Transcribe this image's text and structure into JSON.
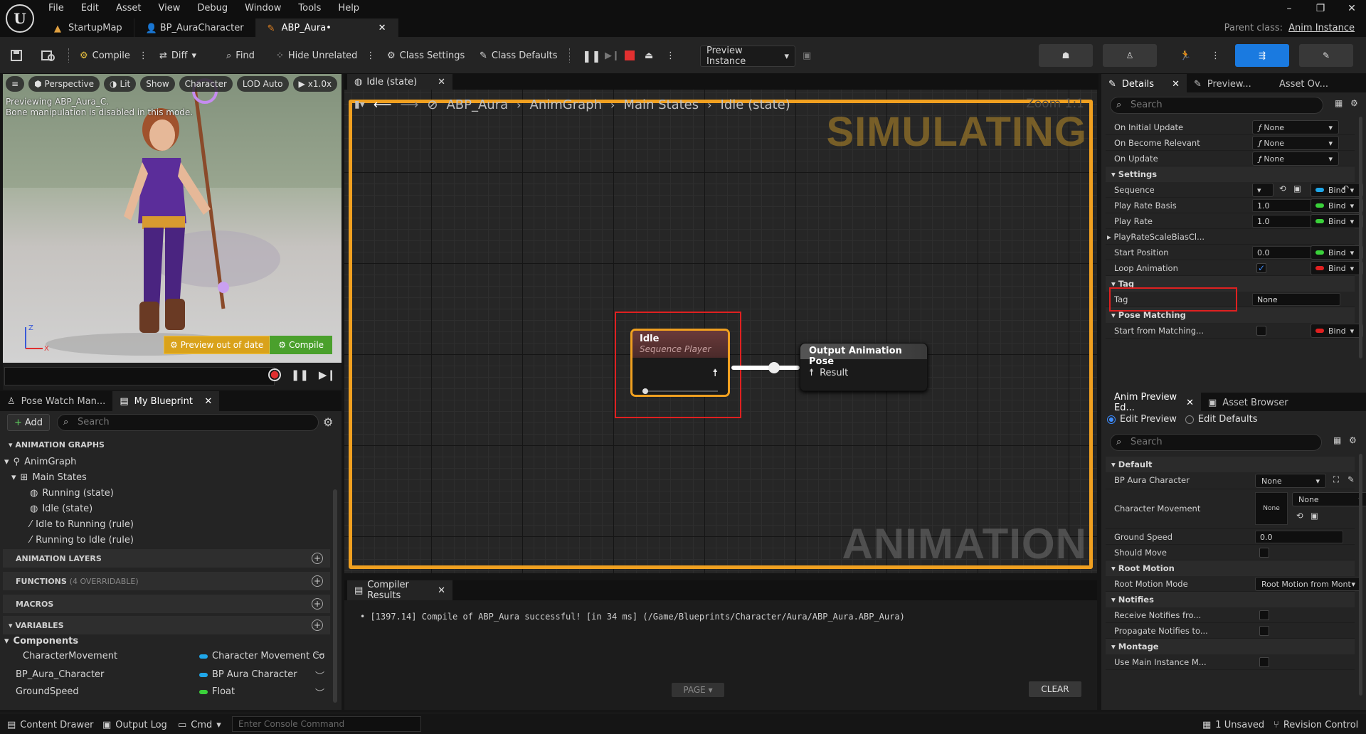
{
  "menu": [
    "File",
    "Edit",
    "Asset",
    "View",
    "Debug",
    "Window",
    "Tools",
    "Help"
  ],
  "doc_tabs": [
    {
      "label": "StartupMap",
      "icon": "map-icon"
    },
    {
      "label": "BP_AuraCharacter",
      "icon": "character-icon"
    },
    {
      "label": "ABP_Aura•",
      "icon": "anim-blueprint-icon"
    }
  ],
  "parent_class": {
    "label": "Parent class:",
    "value": "Anim Instance"
  },
  "toolbar": {
    "compile": "Compile",
    "diff": "Diff",
    "find": "Find",
    "hide_unrelated": "Hide Unrelated",
    "class_settings": "Class Settings",
    "class_defaults": "Class Defaults",
    "preview_instance": "Preview Instance"
  },
  "viewport": {
    "perspective": "Perspective",
    "lit": "Lit",
    "show": "Show",
    "character": "Character",
    "lod": "LOD Auto",
    "speed": "x1.0x",
    "message_line1": "Previewing ABP_Aura_C.",
    "message_line2": "Bone manipulation is disabled in this mode.",
    "preview_out_of_date": "Preview out of date",
    "compile": "Compile",
    "axis_z": "Z",
    "axis_x": "X"
  },
  "left_tabs": {
    "pose_watch": "Pose Watch Man...",
    "my_blueprint": "My Blueprint"
  },
  "my_blueprint": {
    "add": "Add",
    "search_placeholder": "Search",
    "sections": {
      "animation_graphs": "ANIMATION GRAPHS",
      "animation_layers": "ANIMATION LAYERS",
      "functions": "FUNCTIONS",
      "functions_note": "(4 OVERRIDABLE)",
      "macros": "MACROS",
      "variables": "VARIABLES"
    },
    "tree": {
      "anim_graph": "AnimGraph",
      "main_states": "Main States",
      "running_state": "Running (state)",
      "idle_state": "Idle (state)",
      "idle_to_running": "Idle to Running (rule)",
      "running_to_idle": "Running to Idle (rule)"
    },
    "components_label": "Components",
    "variables": [
      {
        "name": "CharacterMovement",
        "type": "Character Movement Co",
        "color": "#1fa6e8"
      },
      {
        "name": "BP_Aura_Character",
        "type": "BP Aura Character",
        "color": "#1fa6e8"
      },
      {
        "name": "GroundSpeed",
        "type": "Float",
        "color": "#3ad13a"
      }
    ]
  },
  "graph": {
    "tab": "Idle (state)",
    "breadcrumb": [
      "ABP_Aura",
      "AnimGraph",
      "Main States",
      "Idle (state)"
    ],
    "zoom": "Zoom 1:1",
    "watermark_top": "SIMULATING",
    "watermark_bottom": "ANIMATION",
    "idle_node": {
      "title": "Idle",
      "subtitle": "Sequence Player"
    },
    "output_node": {
      "title": "Output Animation Pose",
      "pin": "Result"
    }
  },
  "compiler": {
    "tab": "Compiler Results",
    "message": "• [1397.14] Compile of ABP_Aura successful! [in 34 ms] (/Game/Blueprints/Character/Aura/ABP_Aura.ABP_Aura)",
    "page": "PAGE",
    "clear": "CLEAR"
  },
  "details": {
    "tabs": [
      "Details",
      "Preview...",
      "Asset Ov..."
    ],
    "search_placeholder": "Search",
    "function_rows": [
      {
        "label": "On Initial Update",
        "value": "None"
      },
      {
        "label": "On Become Relevant",
        "value": "None"
      },
      {
        "label": "On Update",
        "value": "None"
      }
    ],
    "settings_title": "Settings",
    "sequence_label": "Sequence",
    "play_rate_basis": {
      "label": "Play Rate Basis",
      "value": "1.0"
    },
    "play_rate": {
      "label": "Play Rate",
      "value": "1.0"
    },
    "play_rate_scale": "PlayRateScaleBiasCl...",
    "start_position": {
      "label": "Start Position",
      "value": "0.0"
    },
    "loop_animation": {
      "label": "Loop Animation",
      "checked": "✓"
    },
    "bind": "Bind",
    "tag_section": "Tag",
    "tag": {
      "label": "Tag",
      "value": "None"
    },
    "pose_matching_section": "Pose Matching",
    "start_from_matching": "Start from Matching...",
    "bind_colors": {
      "blue": "#1fa6e8",
      "green": "#3ad13a",
      "red": "#e02020"
    }
  },
  "anim_preview": {
    "tabs": [
      "Anim Preview Ed...",
      "Asset Browser"
    ],
    "edit_preview": "Edit Preview",
    "edit_defaults": "Edit Defaults",
    "search_placeholder": "Search",
    "default_section": "Default",
    "bp_aura_character": {
      "label": "BP Aura Character",
      "value": "None"
    },
    "character_movement": {
      "label": "Character Movement",
      "thumb": "None",
      "value": "None"
    },
    "ground_speed": {
      "label": "Ground Speed",
      "value": "0.0"
    },
    "should_move": "Should Move",
    "root_motion_section": "Root Motion",
    "root_motion_mode": {
      "label": "Root Motion Mode",
      "value": "Root Motion from Montage"
    },
    "notifies_section": "Notifies",
    "receive_notifies": "Receive Notifies fro...",
    "propagate_notifies": "Propagate Notifies to...",
    "montage_section": "Montage",
    "use_main_instance": "Use Main Instance M..."
  },
  "statusbar": {
    "content_drawer": "Content Drawer",
    "output_log": "Output Log",
    "cmd": "Cmd",
    "console_placeholder": "Enter Console Command",
    "unsaved": "1 Unsaved",
    "revision_control": "Revision Control"
  }
}
